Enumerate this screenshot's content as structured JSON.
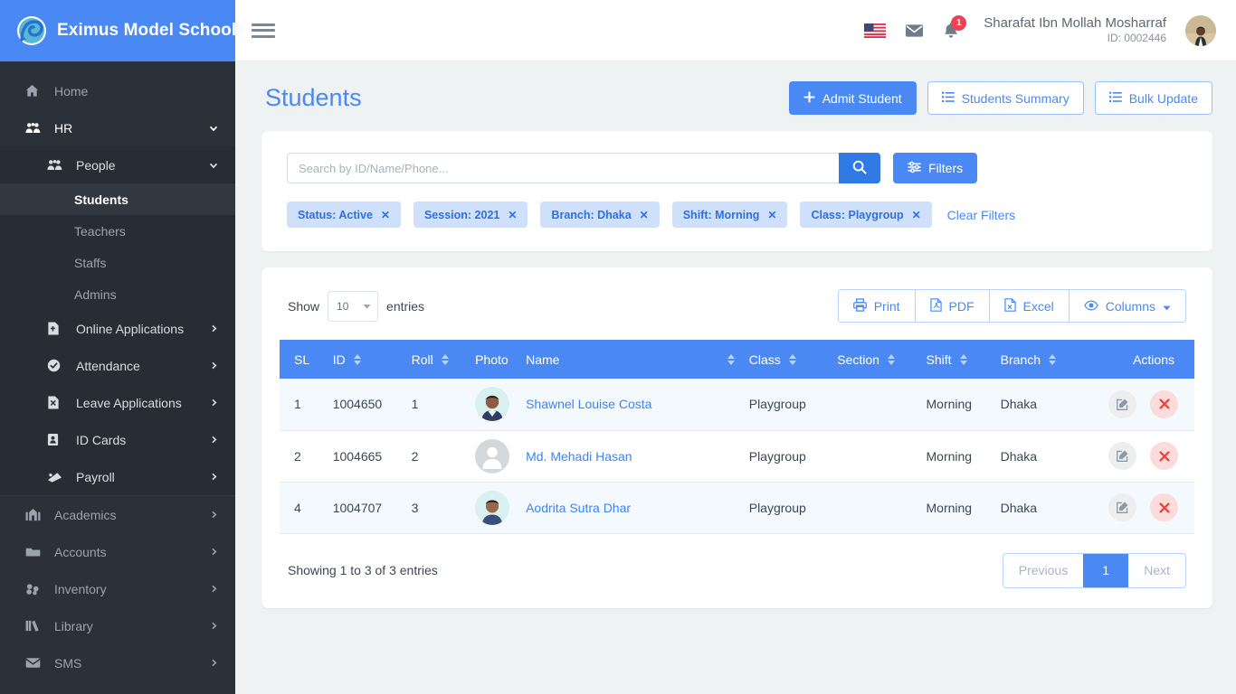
{
  "brand": {
    "name": "Eximus Model School",
    "logo_icon": "spiral-logo-icon"
  },
  "sidebar": {
    "items": [
      {
        "label": "Home",
        "icon": "home-icon",
        "level": 1,
        "arrow": "",
        "active": false
      },
      {
        "label": "HR",
        "icon": "people-group-icon",
        "level": 1,
        "arrow": "chevron-down-icon",
        "active": false,
        "open": true
      },
      {
        "label": "People",
        "icon": "people-group-icon",
        "level": 2,
        "arrow": "chevron-down-icon",
        "active": false,
        "open": true
      },
      {
        "label": "Students",
        "icon": "",
        "level": 3,
        "arrow": "",
        "active": true
      },
      {
        "label": "Teachers",
        "icon": "",
        "level": 3,
        "arrow": "",
        "active": false
      },
      {
        "label": "Staffs",
        "icon": "",
        "level": 3,
        "arrow": "",
        "active": false
      },
      {
        "label": "Admins",
        "icon": "",
        "level": 3,
        "arrow": "",
        "active": false
      },
      {
        "label": "Online Applications",
        "icon": "document-plus-icon",
        "level": 2,
        "arrow": "chevron-right-icon",
        "active": false
      },
      {
        "label": "Attendance",
        "icon": "check-circle-icon",
        "level": 2,
        "arrow": "chevron-right-icon",
        "active": false
      },
      {
        "label": "Leave Applications",
        "icon": "document-x-icon",
        "level": 2,
        "arrow": "chevron-right-icon",
        "active": false
      },
      {
        "label": "ID Cards",
        "icon": "id-card-icon",
        "level": 2,
        "arrow": "chevron-right-icon",
        "active": false
      },
      {
        "label": "Payroll",
        "icon": "payroll-icon",
        "level": 2,
        "arrow": "chevron-right-icon",
        "active": false
      },
      {
        "label": "Academics",
        "icon": "building-icon",
        "level": 1,
        "arrow": "chevron-right-icon",
        "active": false
      },
      {
        "label": "Accounts",
        "icon": "folder-icon",
        "level": 1,
        "arrow": "chevron-right-icon",
        "active": false
      },
      {
        "label": "Inventory",
        "icon": "boxes-icon",
        "level": 1,
        "arrow": "chevron-right-icon",
        "active": false
      },
      {
        "label": "Library",
        "icon": "books-icon",
        "level": 1,
        "arrow": "chevron-right-icon",
        "active": false
      },
      {
        "label": "SMS",
        "icon": "envelope-icon",
        "level": 1,
        "arrow": "chevron-right-icon",
        "active": false
      }
    ]
  },
  "topbar": {
    "menu_icon": "hamburger-icon",
    "language_flag": "us-flag-icon",
    "messages_icon": "envelope-icon",
    "notifications_icon": "bell-icon",
    "notification_count": "1",
    "user_name": "Sharafat Ibn Mollah Mosharraf",
    "user_id": "ID: 0002446",
    "avatar_icon": "user-avatar"
  },
  "page": {
    "title": "Students",
    "buttons": [
      {
        "label": "Admit Student",
        "icon": "plus-icon",
        "style": "primary"
      },
      {
        "label": "Students Summary",
        "icon": "list-icon",
        "style": "outline"
      },
      {
        "label": "Bulk Update",
        "icon": "list-icon",
        "style": "outline"
      }
    ]
  },
  "search": {
    "value": "",
    "placeholder": "Search by ID/Name/Phone...",
    "search_icon": "search-icon",
    "filters_label": "Filters",
    "filters_icon": "sliders-icon"
  },
  "filter_chips": [
    {
      "label": "Status: Active",
      "remove_icon": "close-icon"
    },
    {
      "label": "Session: 2021",
      "remove_icon": "close-icon"
    },
    {
      "label": "Branch: Dhaka",
      "remove_icon": "close-icon"
    },
    {
      "label": "Shift: Morning",
      "remove_icon": "close-icon"
    },
    {
      "label": "Class: Playgroup",
      "remove_icon": "close-icon"
    }
  ],
  "clear_filters_label": "Clear Filters",
  "table_toolbar": {
    "show_label": "Show",
    "entries_value": "10",
    "entries_label": "entries",
    "exports": [
      {
        "label": "Print",
        "icon": "printer-icon"
      },
      {
        "label": "PDF",
        "icon": "pdf-file-icon"
      },
      {
        "label": "Excel",
        "icon": "excel-file-icon"
      },
      {
        "label": "Columns",
        "icon": "eye-icon",
        "caret": true
      }
    ]
  },
  "table": {
    "columns": [
      {
        "label": "SL",
        "sortable": false
      },
      {
        "label": "ID",
        "sortable": true
      },
      {
        "label": "Roll",
        "sortable": true
      },
      {
        "label": "Photo",
        "sortable": false
      },
      {
        "label": "Name",
        "sortable": true
      },
      {
        "label": "Class",
        "sortable": true
      },
      {
        "label": "Section",
        "sortable": true
      },
      {
        "label": "Shift",
        "sortable": true
      },
      {
        "label": "Branch",
        "sortable": true
      },
      {
        "label": "Actions",
        "sortable": false
      }
    ],
    "rows": [
      {
        "sl": "1",
        "id": "1004650",
        "roll": "1",
        "photo": "student-photo",
        "name": "Shawnel Louise Costa",
        "class": "Playgroup",
        "section": "",
        "shift": "Morning",
        "branch": "Dhaka"
      },
      {
        "sl": "2",
        "id": "1004665",
        "roll": "2",
        "photo": "placeholder-avatar",
        "name": "Md. Mehadi Hasan",
        "class": "Playgroup",
        "section": "",
        "shift": "Morning",
        "branch": "Dhaka"
      },
      {
        "sl": "4",
        "id": "1004707",
        "roll": "3",
        "photo": "student-photo",
        "name": "Aodrita Sutra Dhar",
        "class": "Playgroup",
        "section": "",
        "shift": "Morning",
        "branch": "Dhaka"
      }
    ],
    "row_actions": {
      "edit_icon": "edit-pencil-icon",
      "delete_icon": "delete-x-icon"
    }
  },
  "footer": {
    "showing_text": "Showing 1 to 3 of 3 entries",
    "pagination": {
      "previous": "Previous",
      "pages": [
        "1"
      ],
      "next": "Next",
      "current": "1"
    }
  },
  "colors": {
    "brand_blue": "#4a89f3",
    "sidebar_dark": "#2b3138",
    "page_bg": "#eef2f3",
    "chip_bg": "#cfe0fc",
    "danger_red": "#e8453c",
    "badge_red": "#ef4054"
  }
}
